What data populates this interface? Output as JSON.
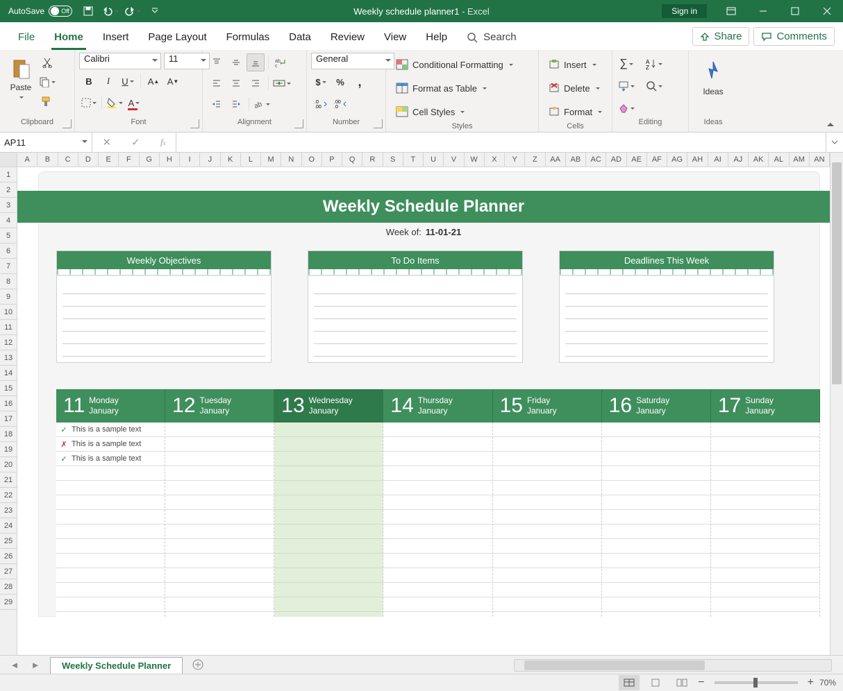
{
  "titlebar": {
    "autosave_label": "AutoSave",
    "autosave_state": "Off",
    "doc_title": "Weekly schedule planner1",
    "app_name": "  -  Excel",
    "signin": "Sign in"
  },
  "tabs": {
    "file": "File",
    "home": "Home",
    "insert": "Insert",
    "page_layout": "Page Layout",
    "formulas": "Formulas",
    "data": "Data",
    "review": "Review",
    "view": "View",
    "help": "Help",
    "search": "Search",
    "share": "Share",
    "comments": "Comments"
  },
  "ribbon": {
    "clipboard": {
      "paste": "Paste",
      "label": "Clipboard"
    },
    "font": {
      "name": "Calibri",
      "size": "11",
      "label": "Font"
    },
    "alignment": {
      "label": "Alignment"
    },
    "number": {
      "format": "General",
      "label": "Number"
    },
    "styles": {
      "cf": "Conditional Formatting",
      "fat": "Format as Table",
      "cs": "Cell Styles",
      "label": "Styles"
    },
    "cells": {
      "insert": "Insert",
      "delete": "Delete",
      "format": "Format",
      "label": "Cells"
    },
    "editing": {
      "label": "Editing"
    },
    "ideas": {
      "label": "Ideas",
      "btn": "Ideas"
    }
  },
  "fx": {
    "namebox": "AP11"
  },
  "colheaders": [
    "A",
    "B",
    "C",
    "D",
    "E",
    "F",
    "G",
    "H",
    "I",
    "J",
    "K",
    "L",
    "M",
    "N",
    "O",
    "P",
    "Q",
    "R",
    "S",
    "T",
    "U",
    "V",
    "W",
    "X",
    "Y",
    "Z",
    "AA",
    "AB",
    "AC",
    "AD",
    "AE",
    "AF",
    "AG",
    "AH",
    "AI",
    "AJ",
    "AK",
    "AL",
    "AM",
    "AN"
  ],
  "rowheaders": [
    "1",
    "2",
    "3",
    "4",
    "5",
    "6",
    "7",
    "8",
    "9",
    "10",
    "11",
    "12",
    "13",
    "14",
    "15",
    "16",
    "17",
    "18",
    "19",
    "20",
    "21",
    "22",
    "23",
    "24",
    "25",
    "26",
    "27",
    "28",
    "29"
  ],
  "planner": {
    "title": "Weekly Schedule Planner",
    "weekof_label": "Week of:",
    "weekof_date": "11-01-21",
    "cards": [
      "Weekly Objectives",
      "To Do Items",
      "Deadlines This Week"
    ],
    "days": [
      {
        "num": "11",
        "dow": "Monday",
        "mon": "January"
      },
      {
        "num": "12",
        "dow": "Tuesday",
        "mon": "January"
      },
      {
        "num": "13",
        "dow": "Wednesday",
        "mon": "January"
      },
      {
        "num": "14",
        "dow": "Thursday",
        "mon": "January"
      },
      {
        "num": "15",
        "dow": "Friday",
        "mon": "January"
      },
      {
        "num": "16",
        "dow": "Saturday",
        "mon": "January"
      },
      {
        "num": "17",
        "dow": "Sunday",
        "mon": "January"
      }
    ],
    "today_index": 2,
    "entries": [
      {
        "mark": "ok",
        "text": "This is a sample text"
      },
      {
        "mark": "no",
        "text": "This is a sample text"
      },
      {
        "mark": "ok",
        "text": "This is a sample text"
      }
    ]
  },
  "sheets": {
    "tab": "Weekly Schedule Planner"
  },
  "status": {
    "zoom": "70%"
  }
}
